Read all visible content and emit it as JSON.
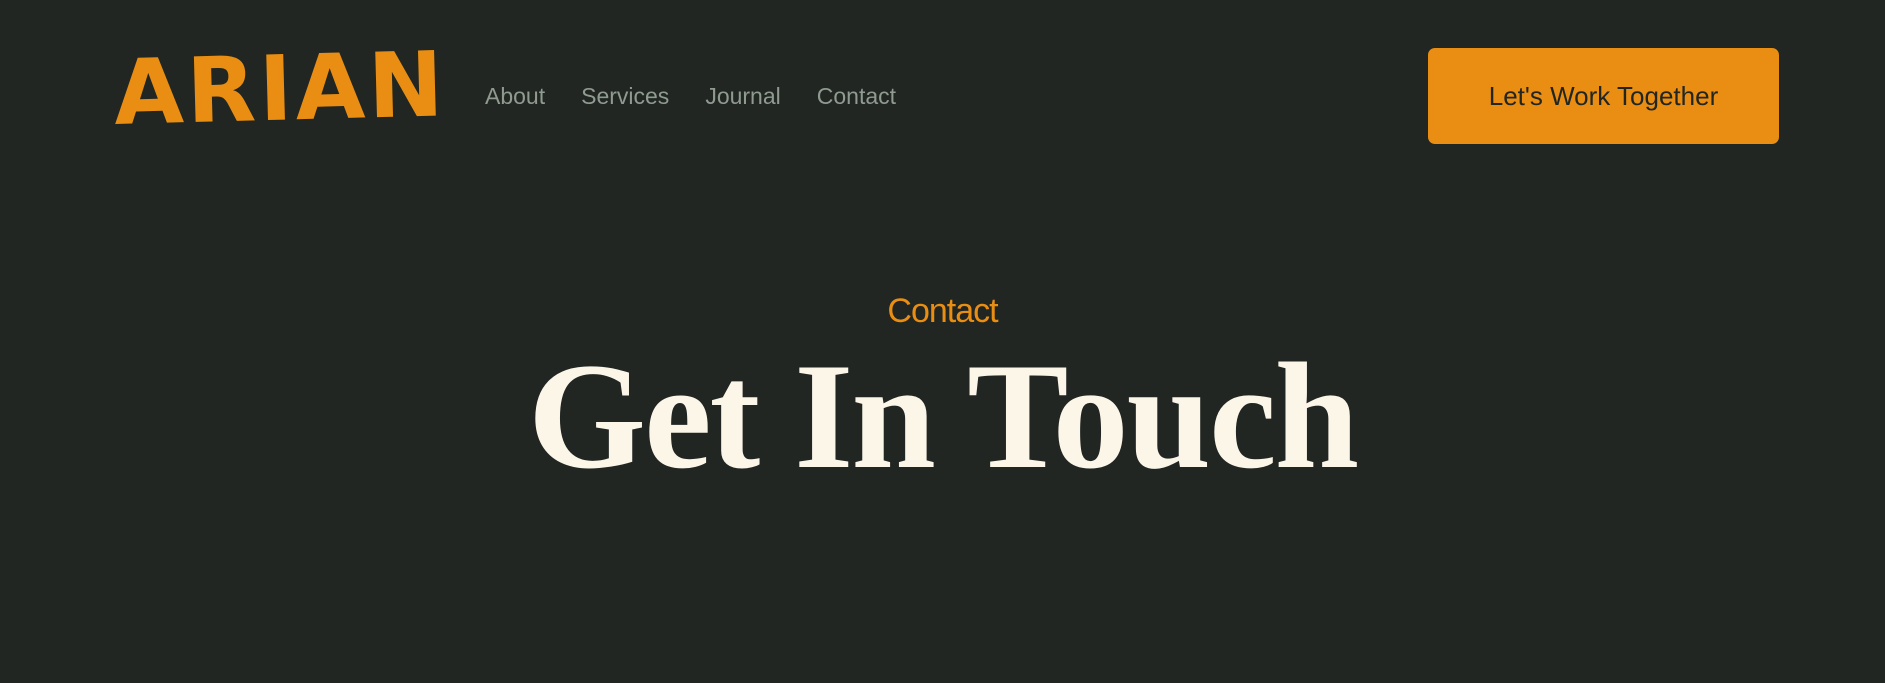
{
  "header": {
    "logo_text": "ARIAN",
    "nav": {
      "items": [
        {
          "label": "About"
        },
        {
          "label": "Services"
        },
        {
          "label": "Journal"
        },
        {
          "label": "Contact"
        }
      ]
    },
    "cta_label": "Let's Work Together"
  },
  "hero": {
    "eyebrow": "Contact",
    "title": "Get In Touch"
  },
  "colors": {
    "background": "#212623",
    "accent": "#e98e12",
    "nav_text": "#8f9a91",
    "title_text": "#fcf6e9"
  }
}
